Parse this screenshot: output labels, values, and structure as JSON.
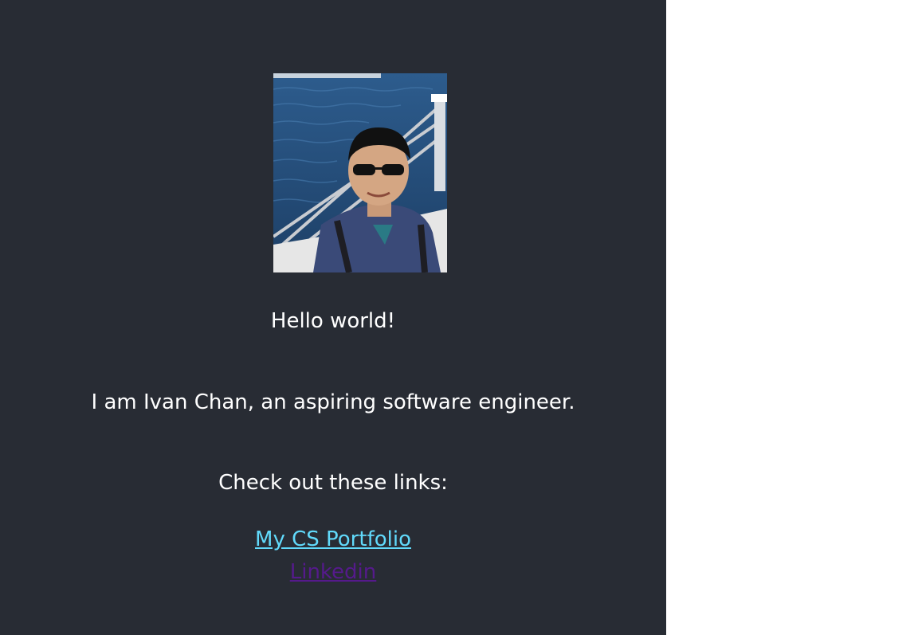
{
  "profile": {
    "photo_icon": "person-photo"
  },
  "content": {
    "greeting": "Hello world!",
    "intro": "I am Ivan Chan, an aspiring software engineer.",
    "links_intro": "Check out these links:"
  },
  "links": {
    "portfolio": "My CS Portfolio",
    "linkedin": "Linkedin"
  },
  "colors": {
    "background": "#282c34",
    "text": "#ffffff",
    "link_unvisited": "#61dafb",
    "link_visited": "#551a8b"
  }
}
